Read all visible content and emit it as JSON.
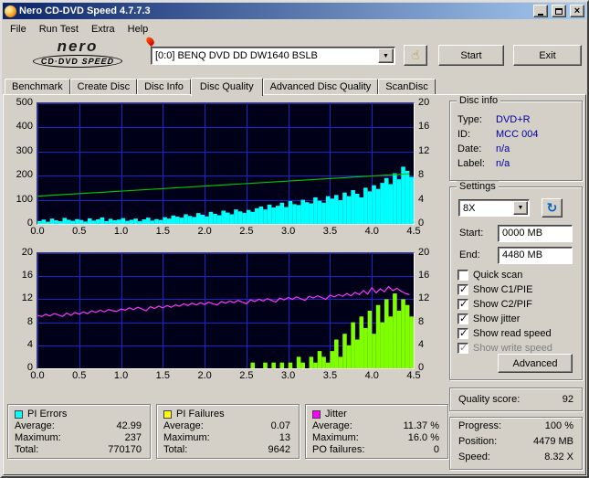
{
  "window": {
    "title": "Nero CD-DVD Speed 4.7.7.3"
  },
  "menu": {
    "items": [
      "File",
      "Run Test",
      "Extra",
      "Help"
    ]
  },
  "header": {
    "logo_top": "nero",
    "logo_bottom_plain": "CD·DVD",
    "logo_bottom_italic": "SPEED",
    "drive_value": "[0:0]   BENQ DVD DD DW1640 BSLB",
    "start_label": "Start",
    "exit_label": "Exit"
  },
  "tabs": {
    "items": [
      "Benchmark",
      "Create Disc",
      "Disc Info",
      "Disc Quality",
      "Advanced Disc Quality",
      "ScanDisc"
    ],
    "active": "Disc Quality"
  },
  "disc_info": {
    "title": "Disc info",
    "rows": [
      [
        "Type:",
        "DVD+R"
      ],
      [
        "ID:",
        "MCC 004"
      ],
      [
        "Date:",
        "n/a"
      ],
      [
        "Label:",
        "n/a"
      ]
    ]
  },
  "settings": {
    "title": "Settings",
    "speed_value": "8X",
    "start_label": "Start:",
    "start_value": "0000 MB",
    "end_label": "End:",
    "end_value": "4480 MB",
    "checkboxes": [
      {
        "label": "Quick scan",
        "checked": false,
        "disabled": false
      },
      {
        "label": "Show C1/PIE",
        "checked": true,
        "disabled": false
      },
      {
        "label": "Show C2/PIF",
        "checked": true,
        "disabled": false
      },
      {
        "label": "Show jitter",
        "checked": true,
        "disabled": false
      },
      {
        "label": "Show read speed",
        "checked": true,
        "disabled": false
      },
      {
        "label": "Show write speed",
        "checked": true,
        "disabled": true
      }
    ],
    "advanced_label": "Advanced"
  },
  "quality": {
    "label": "Quality score:",
    "value": "92"
  },
  "progress": {
    "rows": [
      [
        "Progress:",
        "100 %"
      ],
      [
        "Position:",
        "4479 MB"
      ],
      [
        "Speed:",
        "8.32 X"
      ]
    ]
  },
  "stats": [
    {
      "title": "PI Errors",
      "color": "#00ffff",
      "rows": [
        [
          "Average:",
          "42.99"
        ],
        [
          "Maximum:",
          "237"
        ],
        [
          "Total:",
          "770170"
        ]
      ]
    },
    {
      "title": "PI Failures",
      "color": "#ffff00",
      "rows": [
        [
          "Average:",
          "0.07"
        ],
        [
          "Maximum:",
          "13"
        ],
        [
          "Total:",
          "9642"
        ]
      ]
    },
    {
      "title": "Jitter",
      "color": "#ff00ff",
      "rows": [
        [
          "Average:",
          "11.37 %"
        ],
        [
          "Maximum:",
          "16.0 %"
        ],
        [
          "PO failures:",
          "0"
        ]
      ]
    }
  ],
  "chart_data": [
    {
      "type": "area+line",
      "title": "PI Errors / read speed vs position (GB)",
      "bg": "#000018",
      "grid": "#2222cc",
      "x_range": [
        0,
        4.5
      ],
      "x_start": 0,
      "x_step": 0.05,
      "x_ticks": [
        "0.0",
        "0.5",
        "1.0",
        "1.5",
        "2.0",
        "2.5",
        "3.0",
        "3.5",
        "4.0",
        "4.5"
      ],
      "left_axis": {
        "range": [
          0,
          500
        ],
        "ticks": [
          0,
          100,
          200,
          300,
          400,
          500
        ]
      },
      "right_axis": {
        "range": [
          0,
          20
        ],
        "ticks": [
          0,
          4,
          8,
          12,
          16,
          20
        ]
      },
      "series": [
        {
          "name": "PI Errors",
          "style": "bars",
          "axis": "left",
          "color": "#00ffff",
          "values": [
            12,
            18,
            9,
            22,
            15,
            11,
            25,
            17,
            13,
            20,
            16,
            10,
            23,
            14,
            19,
            27,
            12,
            21,
            15,
            18,
            24,
            13,
            17,
            22,
            11,
            19,
            26,
            14,
            20,
            16,
            28,
            22,
            35,
            30,
            26,
            40,
            33,
            29,
            45,
            38,
            31,
            50,
            42,
            36,
            55,
            47,
            40,
            60,
            52,
            46,
            58,
            50,
            65,
            72,
            60,
            80,
            68,
            75,
            88,
            70,
            95,
            82,
            78,
            100,
            90,
            85,
            110,
            96,
            88,
            115,
            105,
            120,
            98,
            130,
            115,
            140,
            125,
            110,
            150,
            135,
            160,
            145,
            170,
            190,
            165,
            210,
            185,
            237,
            220,
            195
          ]
        },
        {
          "name": "Read speed",
          "style": "line",
          "axis": "right",
          "color": "#00c000",
          "x": [
            0,
            4.45
          ],
          "values": [
            4.6,
            8.32
          ]
        }
      ]
    },
    {
      "type": "area+line",
      "title": "Jitter / PI Failures vs position (GB)",
      "bg": "#000018",
      "grid": "#2222cc",
      "x_range": [
        0,
        4.5
      ],
      "x_start": 0,
      "x_step": 0.05,
      "x_ticks": [
        "0.0",
        "0.5",
        "1.0",
        "1.5",
        "2.0",
        "2.5",
        "3.0",
        "3.5",
        "4.0",
        "4.5"
      ],
      "left_axis": {
        "range": [
          0,
          20
        ],
        "ticks": [
          0,
          4,
          8,
          12,
          16,
          20
        ]
      },
      "right_axis": {
        "range": [
          0,
          20
        ],
        "ticks": [
          0,
          4,
          8,
          12,
          16,
          20
        ]
      },
      "series": [
        {
          "name": "PI Failures",
          "style": "bars",
          "axis": "left",
          "color": "#80ff00",
          "values": [
            0,
            0,
            0,
            0,
            0,
            0,
            0,
            0,
            0,
            0,
            0,
            0,
            0,
            0,
            0,
            0,
            0,
            0,
            0,
            0,
            0,
            0,
            0,
            0,
            0,
            0,
            0,
            0,
            0,
            0,
            0,
            0,
            0,
            0,
            0,
            0,
            0,
            0,
            0,
            0,
            0,
            0,
            0,
            0,
            0,
            0,
            0,
            0,
            0,
            0,
            0,
            1,
            0,
            0,
            1,
            0,
            1,
            0,
            1,
            0,
            1,
            0,
            2,
            1,
            0,
            2,
            1,
            3,
            2,
            1,
            3,
            5,
            2,
            6,
            4,
            8,
            5,
            9,
            7,
            10,
            6,
            11,
            8,
            12,
            9,
            13,
            10,
            12,
            11,
            9
          ]
        },
        {
          "name": "Jitter",
          "style": "line",
          "axis": "left",
          "color": "#ff33ff",
          "values": [
            9.2,
            9.0,
            9.4,
            9.1,
            9.5,
            9.3,
            9.0,
            9.6,
            9.2,
            9.7,
            9.4,
            9.8,
            9.5,
            10.0,
            9.7,
            10.1,
            9.8,
            10.2,
            10.0,
            9.9,
            10.3,
            10.1,
            10.5,
            10.2,
            10.6,
            10.3,
            10.0,
            10.7,
            10.4,
            10.8,
            10.5,
            10.9,
            10.6,
            11.0,
            10.8,
            11.2,
            10.9,
            11.3,
            11.0,
            11.4,
            11.1,
            11.5,
            11.2,
            11.0,
            11.6,
            11.3,
            11.7,
            11.4,
            11.8,
            11.5,
            11.2,
            11.9,
            11.6,
            12.0,
            11.7,
            12.1,
            11.8,
            11.5,
            12.2,
            11.9,
            12.3,
            12.0,
            12.4,
            12.1,
            11.8,
            12.5,
            12.2,
            12.6,
            12.3,
            12.0,
            12.7,
            12.4,
            12.8,
            12.5,
            13.0,
            12.6,
            13.2,
            12.8,
            13.5,
            12.9,
            14.0,
            13.1,
            13.8,
            13.3,
            14.2,
            13.5,
            13.9,
            13.4,
            13.0,
            12.8
          ]
        }
      ]
    }
  ]
}
